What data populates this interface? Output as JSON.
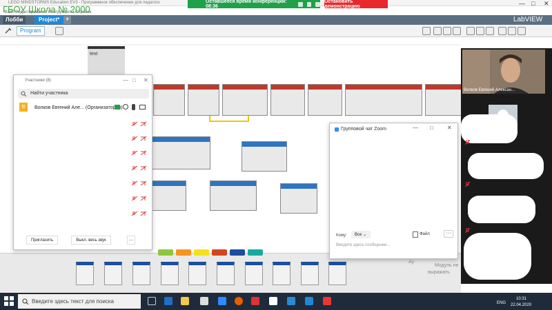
{
  "window": {
    "title": "LEGO MINDSTORMS Education EV3 - Программное обеспечение для педагога",
    "watermark": "ГБОУ Школа № 2000",
    "subline": "Файл Редактирование Инструменты Справка"
  },
  "zoom_bar": {
    "remaining_label": "Оставшееся время конференции: 08:36",
    "stop_demo_label": "Остановить демонстрацию"
  },
  "tabs": {
    "lobby": "Лобби",
    "project": "Project*",
    "add": "+",
    "brand": "LabVIEW"
  },
  "toolbar": {
    "program_tab": "Program"
  },
  "canvas": {
    "text_block_label": "text"
  },
  "participants": {
    "title": "Участники (8)",
    "search_placeholder": "Найти участника",
    "host": {
      "avatar_letter": "В",
      "name": "Волков Евгений Але... (Организатор, я)"
    },
    "invite_button": "Пригласить",
    "mute_all_button": "Выкл. весь звук",
    "more_button": "..."
  },
  "chat": {
    "title": "Групповой чат Zoom",
    "to_label": "Кому:",
    "to_value": "Все",
    "file_label": "Файл",
    "more_label": "···",
    "input_placeholder": "Введите здесь сообщение..."
  },
  "video": {
    "self_name": "Волков Евгений Алексан..."
  },
  "palette": {
    "swatch_colors": [
      "#8dc63f",
      "#f7941d",
      "#f2e21a",
      "#d2451e",
      "#1b4fa0",
      "#17a9a0"
    ],
    "bg_text_1": "Модуль не",
    "bg_text_2": "Ау",
    "bg_text_3": "выражать"
  },
  "taskbar": {
    "search_placeholder": "Введите здесь текст для поиска",
    "language": "ENG",
    "time": "10:31",
    "date": "22.04.2020"
  }
}
